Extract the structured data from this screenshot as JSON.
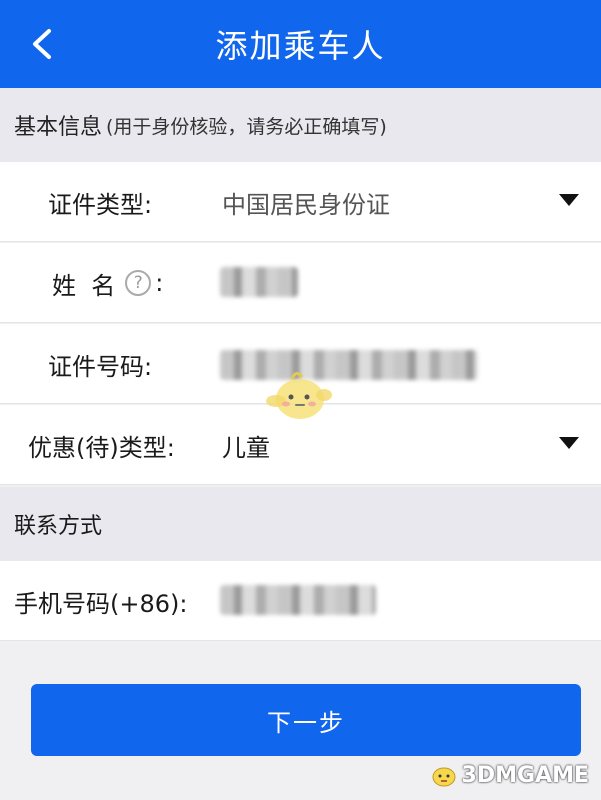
{
  "header": {
    "title": "添加乘车人",
    "back_icon": "chevron-left-icon"
  },
  "basic_info": {
    "title": "基本信息",
    "note": "(用于身份核验，请务必正确填写)"
  },
  "fields": {
    "id_type": {
      "label": "证件类型:",
      "value": "中国居民身份证"
    },
    "name": {
      "label": "姓  名",
      "help_glyph": "?",
      "colon": ":",
      "value_obscured": true
    },
    "id_number": {
      "label": "证件号码:",
      "value_obscured": true
    },
    "discount_type": {
      "label": "优惠(待)类型:",
      "value": "儿童"
    }
  },
  "contact": {
    "title": "联系方式",
    "phone": {
      "label": "手机号码(+86):",
      "value_obscured": true
    }
  },
  "actions": {
    "next_label": "下一步"
  },
  "watermark": {
    "text": "3DMGAME"
  },
  "colors": {
    "primary": "#1166ee",
    "section_bg": "#e8e8ee",
    "row_bg": "#ffffff"
  }
}
